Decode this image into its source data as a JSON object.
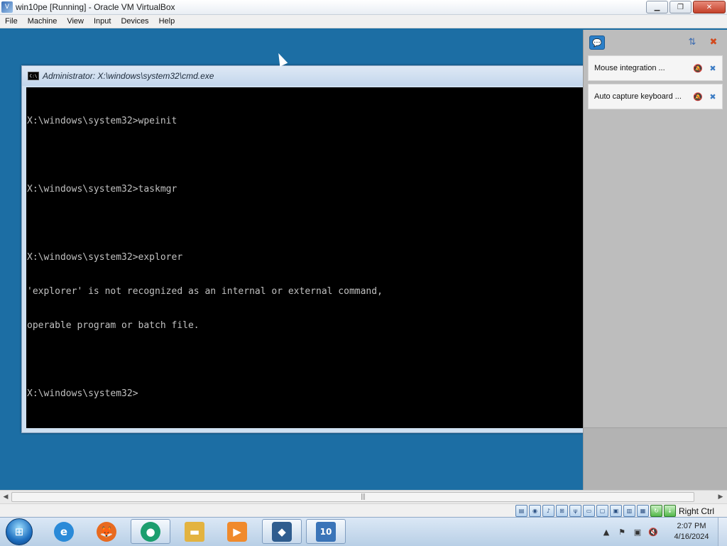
{
  "window": {
    "title": "win10pe [Running] - Oracle VM VirtualBox",
    "controls": {
      "minimize": "▁",
      "restore": "❐",
      "close": "✕"
    }
  },
  "menu": [
    "File",
    "Machine",
    "View",
    "Input",
    "Devices",
    "Help"
  ],
  "cmd": {
    "title": "Administrator: X:\\windows\\system32\\cmd.exe",
    "icon_text": "C:\\",
    "lines": [
      "X:\\windows\\system32>wpeinit",
      "",
      "X:\\windows\\system32>taskmgr",
      "",
      "X:\\windows\\system32>explorer",
      "'explorer' is not recognized as an internal or external command,",
      "operable program or batch file.",
      "",
      "X:\\windows\\system32>"
    ]
  },
  "notifications": {
    "toggle_icon": "message-icon",
    "items": [
      {
        "label": "Mouse integration ..."
      },
      {
        "label": "Auto capture keyboard ..."
      }
    ]
  },
  "statusbar": {
    "host_key": "Right Ctrl",
    "icons": [
      "hard-disk-icon",
      "optical-drive-icon",
      "audio-icon",
      "network-icon",
      "usb-icon",
      "shared-folders-icon",
      "display-icon",
      "video-capture-icon",
      "recording-icon",
      "cpu-icon",
      "mouse-integration-icon",
      "keyboard-capture-icon"
    ]
  },
  "taskbar": {
    "buttons": [
      {
        "name": "internet-explorer",
        "glyph": "e",
        "color": "#2a8ad8",
        "active": false
      },
      {
        "name": "firefox",
        "glyph": "🦊",
        "color": "#e86a1f",
        "active": false
      },
      {
        "name": "chat-app",
        "glyph": "●",
        "color": "#1c9e6e",
        "active": true
      },
      {
        "name": "file-explorer",
        "glyph": "▬",
        "color": "#e3b340",
        "active": false
      },
      {
        "name": "media-player",
        "glyph": "▶",
        "color": "#f08a2c",
        "active": false
      },
      {
        "name": "virtualbox",
        "glyph": "◆",
        "color": "#2f5d8f",
        "active": true
      },
      {
        "name": "win10pe-vm",
        "glyph": "10",
        "color": "#3a74b8",
        "active": true
      }
    ],
    "clock": {
      "time": "2:07 PM",
      "date": "4/16/2024"
    }
  }
}
